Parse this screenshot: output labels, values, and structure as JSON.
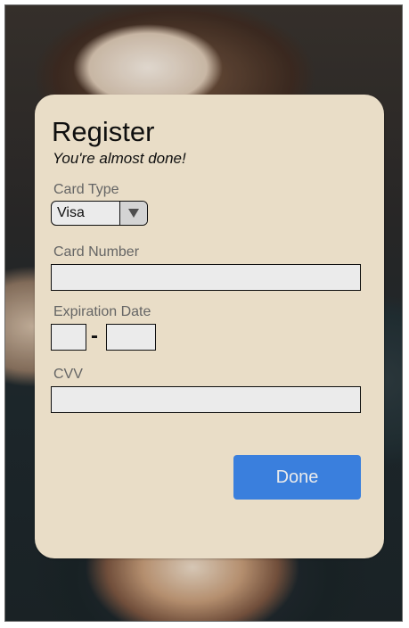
{
  "form": {
    "title": "Register",
    "subtitle": "You're almost done!",
    "card_type": {
      "label": "Card Type",
      "selected": "Visa",
      "arrow_icon": "triangle-down-icon"
    },
    "card_number": {
      "label": "Card Number",
      "value": "",
      "placeholder": ""
    },
    "expiration": {
      "label": "Expiration Date",
      "separator": "-",
      "month_value": "",
      "year_value": ""
    },
    "cvv": {
      "label": "CVV",
      "value": "",
      "placeholder": ""
    },
    "done_label": "Done"
  },
  "colors": {
    "card_background": "#fdf0d8",
    "button_primary": "#3f8af0",
    "label_text": "#6e6e6e"
  }
}
